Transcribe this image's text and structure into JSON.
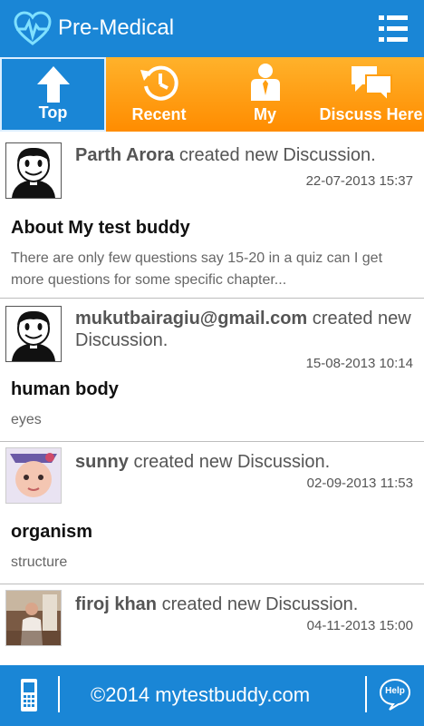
{
  "header": {
    "title": "Pre-Medical"
  },
  "tabs": [
    {
      "label": "Top",
      "icon": "arrow-up-icon",
      "active": true
    },
    {
      "label": "Recent",
      "icon": "history-icon",
      "active": false
    },
    {
      "label": "My",
      "icon": "user-icon",
      "active": false
    },
    {
      "label": "Discuss Here",
      "icon": "chat-bubbles-icon",
      "active": false
    }
  ],
  "discussions": [
    {
      "user": "Parth Arora",
      "action": "created new Discussion.",
      "time": "22-07-2013 15:37",
      "title": "About My test buddy",
      "body": "There are only few questions say 15-20 in a quiz can I get more questions for some specific chapter..."
    },
    {
      "user": "mukutbairagiu@gmail.com",
      "action": "created new Discussion.",
      "time": "15-08-2013 10:14",
      "title": "human body",
      "body": "eyes"
    },
    {
      "user": "sunny",
      "action": "created new Discussion.",
      "time": "02-09-2013 11:53",
      "title": "organism",
      "body": "structure"
    },
    {
      "user": "firoj khan",
      "action": "created new Discussion.",
      "time": "04-11-2013 15:00",
      "title": "",
      "body": ""
    }
  ],
  "footer": {
    "copyright": "©2014 mytestbuddy.com",
    "help_label": "Help"
  },
  "colors": {
    "primary": "#1a86d6",
    "tab_orange": "#ff9e10"
  }
}
